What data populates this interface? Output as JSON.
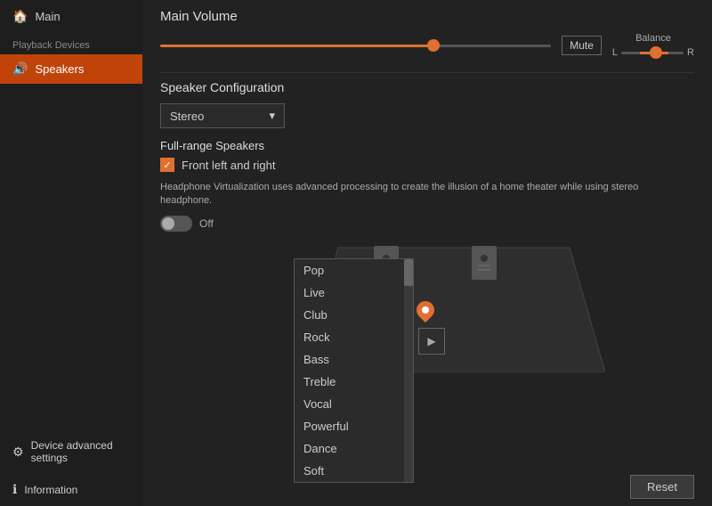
{
  "sidebar": {
    "main_label": "Main",
    "main_icon": "🏠",
    "section_label": "Playback Devices",
    "speakers_label": "Speakers",
    "speakers_icon": "🔊",
    "device_settings_label": "Device advanced settings",
    "device_settings_icon": "⚙",
    "information_label": "Information",
    "information_icon": "ℹ"
  },
  "main_volume": {
    "title": "Main Volume",
    "slider_fill_pct": 70,
    "slider_thumb_pct": 70,
    "mute_label": "Mute",
    "balance_label": "Balance",
    "balance_left": "L",
    "balance_right": "R"
  },
  "speaker_config": {
    "title": "Speaker Configuration",
    "dropdown_value": "Stereo",
    "dropdown_arrow": "▾"
  },
  "full_range": {
    "title": "Full-range Speakers",
    "checkbox_label": "Front left and right"
  },
  "headphone_virt": {
    "description": "Headphone Virtualization uses advanced processing to create the illusion of a home theater while using stereo headphone.",
    "toggle_state": "Off"
  },
  "dropdown_items": [
    "Pop",
    "Live",
    "Club",
    "Rock",
    "Bass",
    "Treble",
    "Vocal",
    "Powerful",
    "Dance",
    "Soft"
  ],
  "reset_label": "Reset",
  "colors": {
    "accent": "#e07030",
    "active_sidebar": "#c0440a"
  }
}
